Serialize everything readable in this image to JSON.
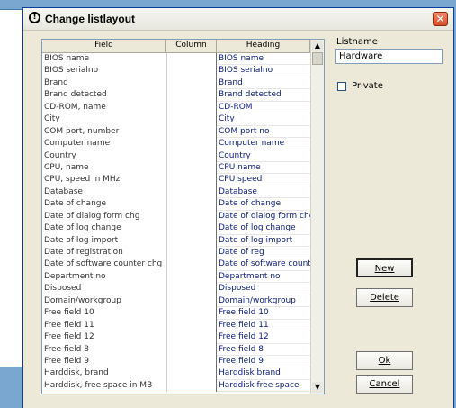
{
  "window": {
    "title": "Change listlayout"
  },
  "grid": {
    "headers": {
      "field": "Field",
      "column": "Column",
      "heading": "Heading"
    },
    "rows": [
      {
        "field": "BIOS name",
        "column": "",
        "heading": "BIOS name"
      },
      {
        "field": "BIOS serialno",
        "column": "",
        "heading": "BIOS serialno"
      },
      {
        "field": "Brand",
        "column": "",
        "heading": "Brand"
      },
      {
        "field": "Brand detected",
        "column": "",
        "heading": "Brand detected"
      },
      {
        "field": "CD-ROM, name",
        "column": "",
        "heading": "CD-ROM"
      },
      {
        "field": "City",
        "column": "",
        "heading": "City"
      },
      {
        "field": "COM port, number",
        "column": "",
        "heading": "COM port no"
      },
      {
        "field": "Computer name",
        "column": "",
        "heading": "Computer name"
      },
      {
        "field": "Country",
        "column": "",
        "heading": "Country"
      },
      {
        "field": "CPU, name",
        "column": "",
        "heading": "CPU name"
      },
      {
        "field": "CPU, speed in MHz",
        "column": "",
        "heading": "CPU speed"
      },
      {
        "field": "Database",
        "column": "",
        "heading": "Database"
      },
      {
        "field": "Date of change",
        "column": "",
        "heading": "Date of change"
      },
      {
        "field": "Date of dialog form chg",
        "column": "",
        "heading": "Date of dialog form chg"
      },
      {
        "field": "Date of log change",
        "column": "",
        "heading": "Date of log change"
      },
      {
        "field": "Date of log import",
        "column": "",
        "heading": "Date of log import"
      },
      {
        "field": "Date of registration",
        "column": "",
        "heading": "Date of reg"
      },
      {
        "field": "Date of software counter chg",
        "column": "",
        "heading": "Date of software counter"
      },
      {
        "field": "Department no",
        "column": "",
        "heading": "Department no"
      },
      {
        "field": "Disposed",
        "column": "",
        "heading": "Disposed"
      },
      {
        "field": "Domain/workgroup",
        "column": "",
        "heading": "Domain/workgroup"
      },
      {
        "field": "Free field 10",
        "column": "",
        "heading": "Free field 10"
      },
      {
        "field": "Free field 11",
        "column": "",
        "heading": "Free field 11"
      },
      {
        "field": "Free field 12",
        "column": "",
        "heading": "Free field 12"
      },
      {
        "field": "Free field 8",
        "column": "",
        "heading": "Free field 8"
      },
      {
        "field": "Free field 9",
        "column": "",
        "heading": "Free field 9"
      },
      {
        "field": "Harddisk, brand",
        "column": "",
        "heading": "Harddisk brand"
      },
      {
        "field": "Harddisk, free space in MB",
        "column": "",
        "heading": "Harddisk free space"
      }
    ]
  },
  "form": {
    "listname_label": "Listname",
    "listname_value": "Hardware",
    "private_label": "Private",
    "private_checked": false
  },
  "buttons": {
    "new": "New",
    "delete": "Delete",
    "ok": "Ok",
    "cancel": "Cancel"
  },
  "icons": {
    "title": "info-circle-icon",
    "close": "close-icon",
    "scroll_up": "arrow-up-icon",
    "scroll_down": "arrow-down-icon"
  }
}
